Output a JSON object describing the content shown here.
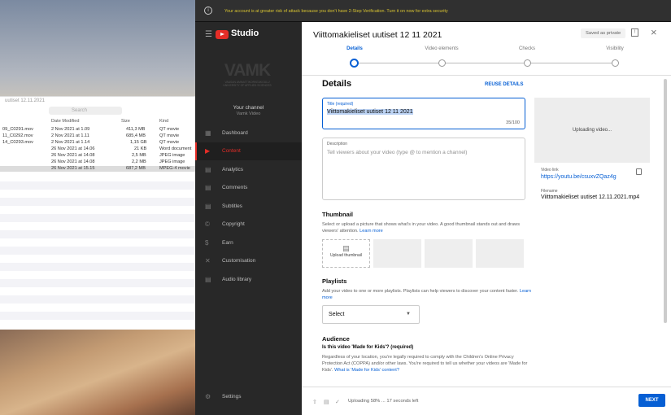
{
  "banner": {
    "text": "Your account is at greater risk of attack because you don't have 2-Step Verification. Turn it on now for extra security"
  },
  "finder": {
    "title": "uutiset 12.11.2021",
    "search_placeholder": "Search",
    "columns": [
      "Date Modified",
      "Size",
      "Kind"
    ],
    "rows": [
      {
        "name": "09_C0291.mov",
        "date": "2 Nov 2021 at 1.09",
        "size": "411,3 MB",
        "kind": "QT movie"
      },
      {
        "name": "11_C0292.mov",
        "date": "2 Nov 2021 at 1.11",
        "size": "685,4 MB",
        "kind": "QT movie"
      },
      {
        "name": "14_C0293.mov",
        "date": "2 Nov 2021 at 1.14",
        "size": "1,15 GB",
        "kind": "QT movie"
      },
      {
        "name": "",
        "date": "26 Nov 2021 at 14.06",
        "size": "21 KB",
        "kind": "Word document"
      },
      {
        "name": "",
        "date": "26 Nov 2021 at 14.08",
        "size": "2,5 MB",
        "kind": "JPEG image"
      },
      {
        "name": "",
        "date": "26 Nov 2021 at 14.08",
        "size": "2,2 MB",
        "kind": "JPEG image"
      },
      {
        "name": "",
        "date": "26 Nov 2021 at 15.15",
        "size": "687,2 MB",
        "kind": "MPEG-4 movie"
      }
    ]
  },
  "studio": {
    "title": "Studio",
    "logo_text": "VAMK",
    "logo_sub": "VAASAN AMMATTIKORKEAKOULU UNIVERSITY OF APPLIED SCIENCES",
    "channel_title": "Your channel",
    "channel_name": "Vamk Video",
    "nav": [
      "Dashboard",
      "Content",
      "Analytics",
      "Comments",
      "Subtitles",
      "Copyright",
      "Earn",
      "Customisation",
      "Audio library"
    ],
    "settings": "Settings"
  },
  "modal": {
    "title": "Viittomakieliset uutiset 12 11 2021",
    "saved": "Saved as private",
    "steps": [
      "Details",
      "Video elements",
      "Checks",
      "Visibility"
    ],
    "details_heading": "Details",
    "reuse": "REUSE DETAILS",
    "title_label": "Title (required)",
    "title_value": "Viittomakieliset uutiset 12 11 2021",
    "title_count": "35/100",
    "desc_label": "Description",
    "desc_placeholder": "Tell viewers about your video (type @ to mention a channel)",
    "preview": "Uploading video...",
    "video_link_label": "Video link",
    "video_link": "https://youtu.be/csuxvZQaz4g",
    "filename_label": "Filename",
    "filename": "Viittomakieliset uutiset 12.11.2021.mp4",
    "thumbnail_heading": "Thumbnail",
    "thumbnail_text": "Select or upload a picture that shows what's in your video. A good thumbnail stands out and draws viewers' attention.",
    "learn_more": "Learn more",
    "upload_thumb": "Upload thumbnail",
    "playlists_heading": "Playlists",
    "playlists_text": "Add your video to one or more playlists. Playlists can help viewers to discover your content faster.",
    "select": "Select",
    "audience_heading": "Audience",
    "audience_q": "Is this video 'Made for Kids'? (required)",
    "audience_text": "Regardless of your location, you're legally required to comply with the Children's Online Privacy Protection Act (COPPA) and/or other laws. You're required to tell us whether your videos are 'Made for Kids'.",
    "audience_link": "What is 'Made for Kids' content?",
    "status": "Uploading 58% ... 17 seconds left",
    "next": "NEXT"
  }
}
